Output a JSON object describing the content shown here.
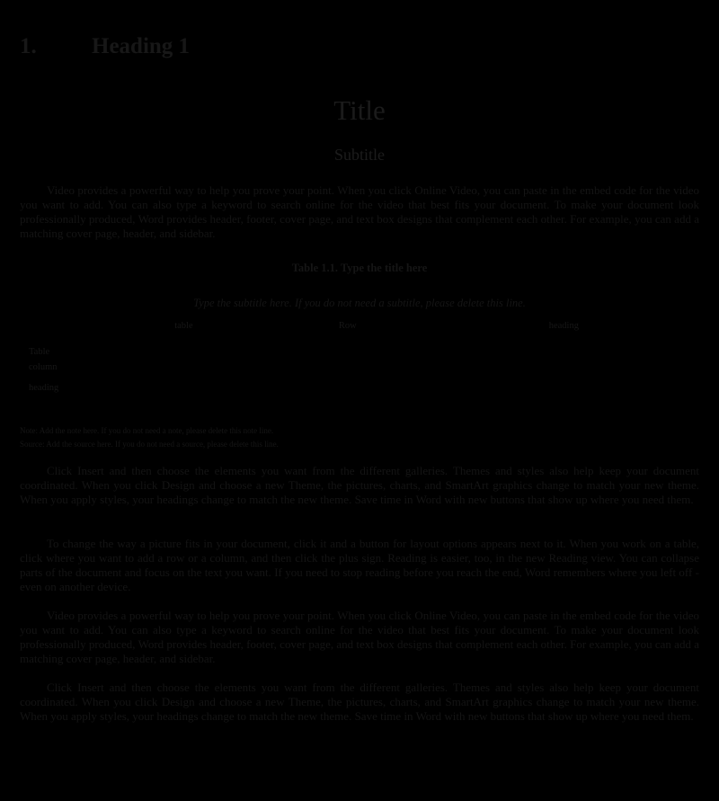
{
  "heading": {
    "number": "1.",
    "text": "Heading 1"
  },
  "title": "Title",
  "subtitle": "Subtitle",
  "paragraphs": [
    "Video provides a powerful way to help you prove your point. When you click Online Video, you can paste in the embed code for the video you want to add. You can also type a keyword to search online for the video that best fits your document. To make your document look professionally produced, Word provides header, footer, cover page, and text box designs that complement each other. For example, you can add a matching cover page, header, and sidebar.",
    "Click Insert and then choose the elements you want from the different galleries. Themes and styles also help keep your document coordinated. When you click Design and choose a new Theme, the pictures, charts, and SmartArt graphics change to match your new theme. When you apply styles, your headings change to match the new theme. Save time in Word with new buttons that show up where you need them.",
    "To change the way a picture fits in your document, click it and a button for layout options appears next to it. When you work on a table, click where you want to add a row or a column, and then click the plus sign. Reading is easier, too, in the new Reading view. You can collapse parts of the document and focus on the text you want. If you need to stop reading before you reach the end, Word remembers where you left off - even on another device.",
    "Video provides a powerful way to help you prove your point. When you click Online Video, you can paste in the embed code for the video you want to add. You can also type a keyword to search online for the video that best fits your document. To make your document look professionally produced, Word provides header, footer, cover page, and text box designs that complement each other. For example, you can add a matching cover page, header, and sidebar.",
    "Click Insert and then choose the elements you want from the different galleries. Themes and styles also help keep your document coordinated. When you click Design and choose a new Theme, the pictures, charts, and SmartArt graphics change to match your new theme. When you apply styles, your headings change to match the new theme. Save time in Word with new buttons that show up where you need them."
  ],
  "table": {
    "caption": "Table 1.1. Type the title here",
    "subtitle": "Type the subtitle here. If you do not need a subtitle, please delete this line.",
    "headers": [
      "",
      "table",
      "Row",
      "heading"
    ],
    "rows": [
      [
        "Table",
        "",
        "",
        ""
      ],
      [
        "column",
        "",
        "",
        ""
      ],
      [
        "heading",
        "",
        "",
        ""
      ]
    ],
    "note": "Note: Add the note here. If you do not need a note, please delete this note line.",
    "source": "Source: Add the source here. If you do not need a source, please delete this line."
  }
}
